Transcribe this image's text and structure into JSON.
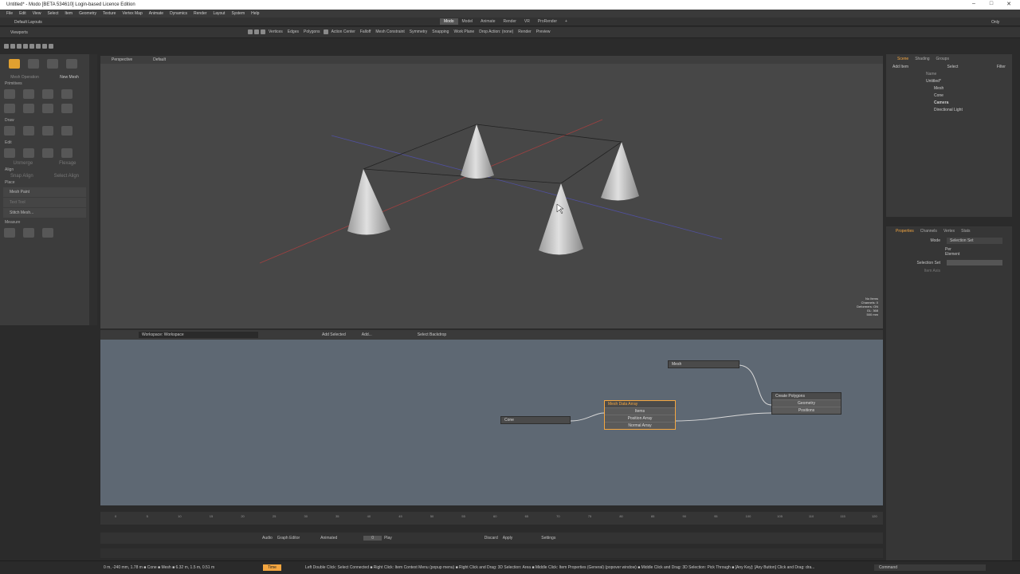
{
  "window": {
    "title": "Untitled* - Modo [BETA 534610] Login-based Licence Edition",
    "controls": [
      "–",
      "□",
      "✕"
    ]
  },
  "menus": [
    "File",
    "Edit",
    "View",
    "Select",
    "Item",
    "Geometry",
    "Texture",
    "Vertex Map",
    "Animate",
    "Dynamics",
    "Render",
    "Layout",
    "System",
    "Help"
  ],
  "layout": {
    "default_layouts": "Default Layouts",
    "tabs": [
      "Modo",
      "Model",
      "Animate",
      "Render",
      "VR",
      "ProRender"
    ],
    "active_tab": "Modo",
    "only_label": "Only"
  },
  "toolrow": {
    "viewports": "Viewports",
    "vertices": "Vertices",
    "edges": "Edges",
    "polygons": "Polygons",
    "action_center": "Action Center",
    "falloff": "Falloff",
    "mesh_constraint": "Mesh Constraint",
    "symmetry": "Symmetry",
    "snapping": "Snapping",
    "work_plane": "Work Plane",
    "drop_action": "Drop Action: (none)",
    "render": "Render",
    "preview": "Preview"
  },
  "toolbox": {
    "mesh_ops": "Mesh Operation",
    "new_mesh": "New Mesh",
    "sections": [
      "Primitives",
      "Draw",
      "Edit",
      "Align",
      "Place",
      "Measure"
    ],
    "edit_sub": [
      "Unmerge",
      "Flexage"
    ],
    "align_sub": [
      "Snap Align",
      "Select Align"
    ],
    "place_items": [
      "Mesh Paint",
      "Text Tool",
      "Stitch Mesh..."
    ]
  },
  "viewport": {
    "view": "Perspective",
    "shading": "Default",
    "info": [
      "No Items",
      "Channels: 0",
      "Deformers: ON",
      "GL: 368",
      "500 mm"
    ]
  },
  "nodegraph": {
    "workspace": "Workspace: Workspace",
    "add_selected": "Add Selected",
    "add": "Add...",
    "select_backdrop": "Select Backdrop",
    "nodes": {
      "mesh": "Mesh",
      "cone": "Cone",
      "mesh_data_array": "Mesh Data Array",
      "mda_ports": [
        "Items",
        "Position Array",
        "Normal Array"
      ],
      "create_polygons": "Create Polygons",
      "cp_ports": [
        "Geometry",
        "Positions"
      ]
    }
  },
  "scene": {
    "tabs": [
      "Scene",
      "Shading",
      "Groups"
    ],
    "add_item": "Add Item",
    "select": "Select",
    "filter": "Filter",
    "name_col": "Name",
    "items": [
      "Untitled*",
      "Mesh",
      "Cone",
      "Camera",
      "Directional Light"
    ]
  },
  "properties": {
    "tabs": [
      "Properties",
      "Channels",
      "Vertex",
      "Stats"
    ],
    "mode_label": "Mode",
    "mode_value": "Selection Set",
    "per_element": "Per Element",
    "selection_set_label": "Selection Set",
    "item_axis_label": "Item Axis"
  },
  "timeline": {
    "ticks": [
      "0",
      "5",
      "10",
      "15",
      "20",
      "25",
      "30",
      "35",
      "40",
      "45",
      "50",
      "55",
      "60",
      "65",
      "70",
      "75",
      "80",
      "85",
      "90",
      "95",
      "100",
      "105",
      "110",
      "115",
      "120"
    ]
  },
  "transport": {
    "audio": "Audio",
    "graph_editor": "Graph Editor",
    "animated": "Animated",
    "frame": "0",
    "play": "Play",
    "discard": "Discard",
    "apply": "Apply",
    "settings": "Settings"
  },
  "status": {
    "left": "0 m, -240 mm, 1.78 m ■ Cone ■ Mesh ■ 6.32 m, 1.5 m, 0.51 m",
    "time": "Time",
    "hints": "Left Double Click: Select Connected ■ Right Click: Item Context Menu (popup menu) ■ Right Click and Drag: 3D Selection: Area ■ Middle Click: Item Properties (General) (popover window) ■ Middle Click and Drag: 3D Selection: Pick Through ■ [Any Key]: [Any Button] Click and Drag: dra...",
    "command": "Command"
  },
  "colors": {
    "accent": "#f4a640",
    "node_bg": "#5e6873",
    "viewport_bg": "#474747"
  }
}
